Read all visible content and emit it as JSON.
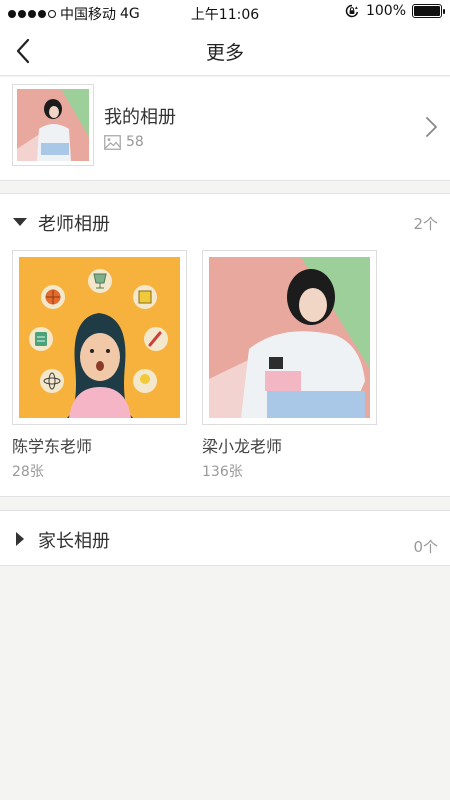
{
  "status_bar": {
    "carrier": "中国移动",
    "network": "4G",
    "time": "上午11:06",
    "battery": "100%",
    "battery_level": 1.0
  },
  "nav": {
    "title": "更多",
    "back_icon": "chevron-left-icon"
  },
  "my_album": {
    "title": "我的相册",
    "count": "58",
    "image_icon": "image-icon"
  },
  "teacher_albums": {
    "title": "老师相册",
    "count": "2个",
    "expanded": true,
    "items": [
      {
        "name": "陈学东老师",
        "count": "28张",
        "bg_color": "#f6b23c"
      },
      {
        "name": "梁小龙老师",
        "count": "136张",
        "bg_color": "#e9a89d"
      }
    ]
  },
  "parent_albums": {
    "title": "家长相册",
    "count": "0个",
    "expanded": false
  },
  "colors": {
    "background": "#f4f4f2",
    "card": "#ffffff",
    "muted_text": "#999999",
    "photo_yellow": "#f6b23c",
    "photo_pink": "#e9a89d",
    "photo_green": "#9ccf9a"
  }
}
